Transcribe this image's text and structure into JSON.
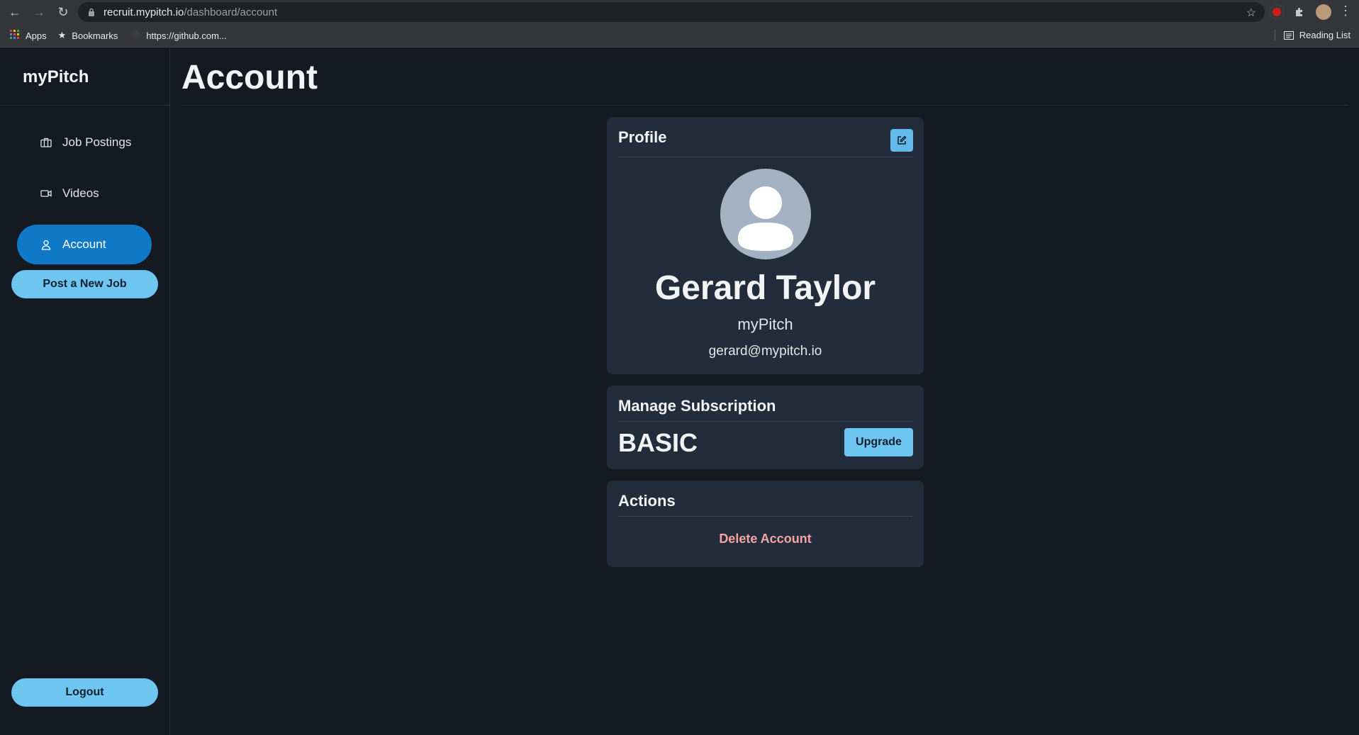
{
  "browser": {
    "url_host": "recruit.mypitch.io",
    "url_path": "/dashboard/account",
    "bookmarks": [
      {
        "label": "Apps",
        "icon": "apps-grid-icon"
      },
      {
        "label": "Bookmarks",
        "icon": "star-icon"
      },
      {
        "label": "https://github.com...",
        "icon": "github-icon"
      }
    ],
    "reading_list": "Reading List"
  },
  "sidebar": {
    "brand": "myPitch",
    "items": [
      {
        "label": "Job Postings",
        "icon": "briefcase-icon"
      },
      {
        "label": "Videos",
        "icon": "video-camera-icon"
      },
      {
        "label": "Account",
        "icon": "user-icon",
        "active": true
      }
    ],
    "post_job_label": "Post a New Job",
    "logout_label": "Logout"
  },
  "main": {
    "title": "Account"
  },
  "profile": {
    "title": "Profile",
    "name": "Gerard Taylor",
    "company": "myPitch",
    "email": "gerard@mypitch.io"
  },
  "subscription": {
    "title": "Manage Subscription",
    "plan": "BASIC",
    "upgrade_label": "Upgrade"
  },
  "actions": {
    "title": "Actions",
    "delete_label": "Delete Account"
  },
  "colors": {
    "background": "#151922",
    "card": "#232c3b",
    "active_nav": "#0f79c8",
    "accent_button": "#6ec5ef",
    "danger_text": "#f5a3a3"
  }
}
